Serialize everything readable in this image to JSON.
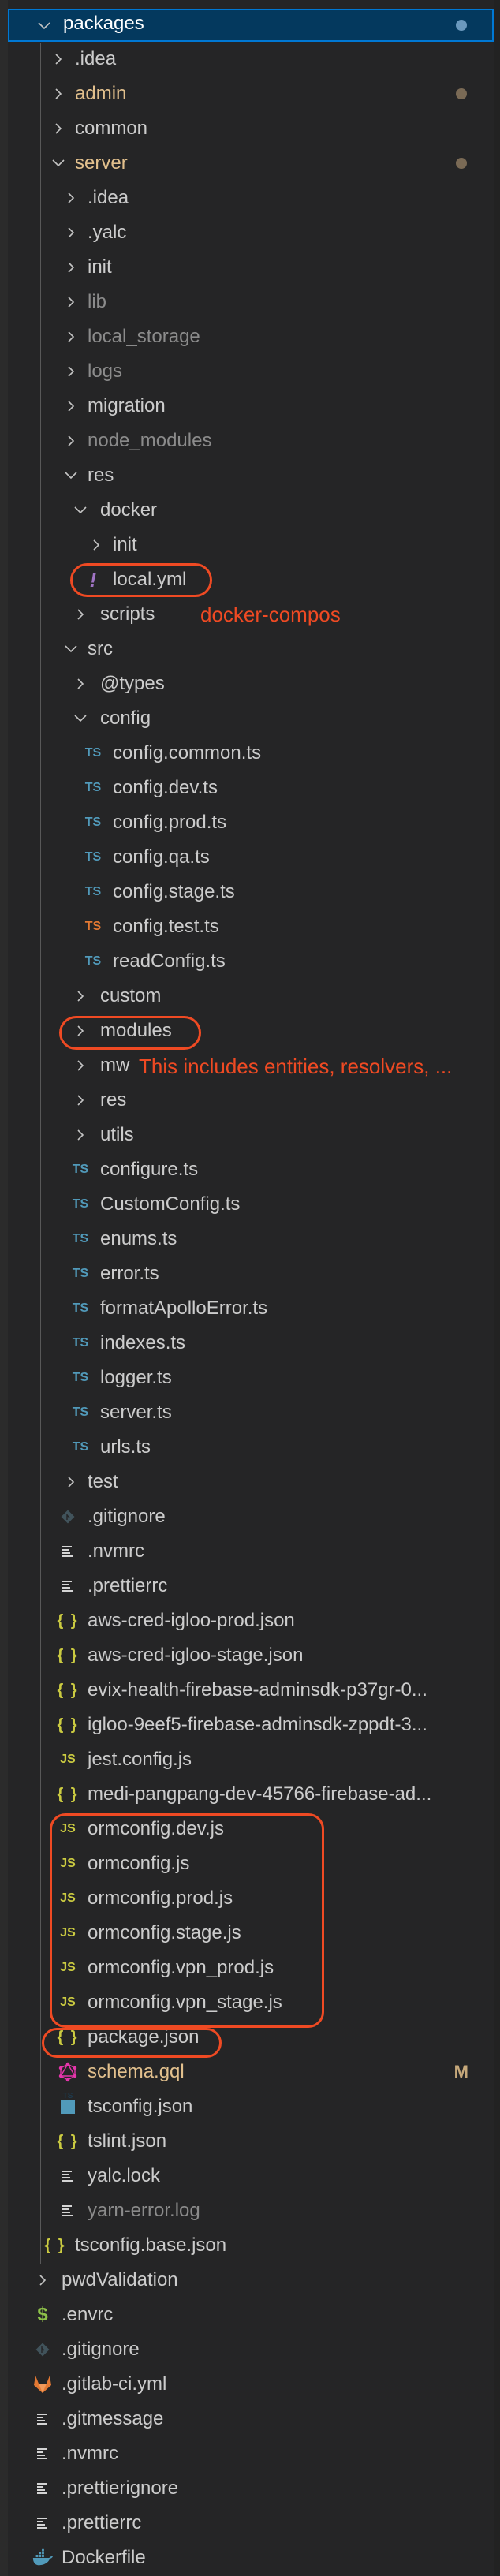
{
  "explorer": {
    "colors": {
      "background": "#252526",
      "selection": "#04395e",
      "selection_border": "#0078d4",
      "modified_text": "#e2c08d",
      "ignored_text": "#8b8b8b",
      "annotation": "#ef4a23"
    },
    "rows": [
      {
        "label": "packages",
        "depth": 0,
        "type": "folder",
        "expanded": true,
        "selected": true,
        "dot": true
      },
      {
        "label": ".idea",
        "depth": 1,
        "type": "folder",
        "expanded": false
      },
      {
        "label": "admin",
        "depth": 1,
        "type": "folder",
        "expanded": false,
        "modified": true,
        "dot": true
      },
      {
        "label": "common",
        "depth": 1,
        "type": "folder",
        "expanded": false
      },
      {
        "label": "server",
        "depth": 1,
        "type": "folder",
        "expanded": true,
        "modified": true,
        "dot": true
      },
      {
        "label": ".idea",
        "depth": 2,
        "type": "folder",
        "expanded": false
      },
      {
        "label": ".yalc",
        "depth": 2,
        "type": "folder",
        "expanded": false
      },
      {
        "label": "init",
        "depth": 2,
        "type": "folder",
        "expanded": false
      },
      {
        "label": "lib",
        "depth": 2,
        "type": "folder",
        "expanded": false,
        "dim": true
      },
      {
        "label": "local_storage",
        "depth": 2,
        "type": "folder",
        "expanded": false,
        "dim": true
      },
      {
        "label": "logs",
        "depth": 2,
        "type": "folder",
        "expanded": false,
        "dim": true
      },
      {
        "label": "migration",
        "depth": 2,
        "type": "folder",
        "expanded": false
      },
      {
        "label": "node_modules",
        "depth": 2,
        "type": "folder",
        "expanded": false,
        "dim": true
      },
      {
        "label": "res",
        "depth": 2,
        "type": "folder",
        "expanded": true
      },
      {
        "label": "docker",
        "depth": 3,
        "type": "folder",
        "expanded": true
      },
      {
        "label": "init",
        "depth": 4,
        "type": "folder",
        "expanded": false
      },
      {
        "label": "local.yml",
        "depth": 4,
        "type": "file",
        "icon": "yaml"
      },
      {
        "label": "scripts",
        "depth": 3,
        "type": "folder",
        "expanded": false
      },
      {
        "label": "src",
        "depth": 2,
        "type": "folder",
        "expanded": true
      },
      {
        "label": "@types",
        "depth": 3,
        "type": "folder",
        "expanded": false
      },
      {
        "label": "config",
        "depth": 3,
        "type": "folder",
        "expanded": true
      },
      {
        "label": "config.common.ts",
        "depth": 4,
        "type": "file",
        "icon": "ts"
      },
      {
        "label": "config.dev.ts",
        "depth": 4,
        "type": "file",
        "icon": "ts"
      },
      {
        "label": "config.prod.ts",
        "depth": 4,
        "type": "file",
        "icon": "ts"
      },
      {
        "label": "config.qa.ts",
        "depth": 4,
        "type": "file",
        "icon": "ts"
      },
      {
        "label": "config.stage.ts",
        "depth": 4,
        "type": "file",
        "icon": "ts"
      },
      {
        "label": "config.test.ts",
        "depth": 4,
        "type": "file",
        "icon": "ts-test"
      },
      {
        "label": "readConfig.ts",
        "depth": 4,
        "type": "file",
        "icon": "ts"
      },
      {
        "label": "custom",
        "depth": 3,
        "type": "folder",
        "expanded": false
      },
      {
        "label": "modules",
        "depth": 3,
        "type": "folder",
        "expanded": false
      },
      {
        "label": "mw",
        "depth": 3,
        "type": "folder",
        "expanded": false
      },
      {
        "label": "res",
        "depth": 3,
        "type": "folder",
        "expanded": false
      },
      {
        "label": "utils",
        "depth": 3,
        "type": "folder",
        "expanded": false
      },
      {
        "label": "configure.ts",
        "depth": 3,
        "type": "file",
        "icon": "ts"
      },
      {
        "label": "CustomConfig.ts",
        "depth": 3,
        "type": "file",
        "icon": "ts"
      },
      {
        "label": "enums.ts",
        "depth": 3,
        "type": "file",
        "icon": "ts"
      },
      {
        "label": "error.ts",
        "depth": 3,
        "type": "file",
        "icon": "ts"
      },
      {
        "label": "formatApolloError.ts",
        "depth": 3,
        "type": "file",
        "icon": "ts"
      },
      {
        "label": "indexes.ts",
        "depth": 3,
        "type": "file",
        "icon": "ts"
      },
      {
        "label": "logger.ts",
        "depth": 3,
        "type": "file",
        "icon": "ts"
      },
      {
        "label": "server.ts",
        "depth": 3,
        "type": "file",
        "icon": "ts"
      },
      {
        "label": "urls.ts",
        "depth": 3,
        "type": "file",
        "icon": "ts"
      },
      {
        "label": "test",
        "depth": 2,
        "type": "folder",
        "expanded": false
      },
      {
        "label": ".gitignore",
        "depth": 2,
        "type": "file",
        "icon": "git"
      },
      {
        "label": ".nvmrc",
        "depth": 2,
        "type": "file",
        "icon": "text"
      },
      {
        "label": ".prettierrc",
        "depth": 2,
        "type": "file",
        "icon": "text"
      },
      {
        "label": "aws-cred-igloo-prod.json",
        "depth": 2,
        "type": "file",
        "icon": "json"
      },
      {
        "label": "aws-cred-igloo-stage.json",
        "depth": 2,
        "type": "file",
        "icon": "json"
      },
      {
        "label": "evix-health-firebase-adminsdk-p37gr-0...",
        "depth": 2,
        "type": "file",
        "icon": "json"
      },
      {
        "label": "igloo-9eef5-firebase-adminsdk-zppdt-3...",
        "depth": 2,
        "type": "file",
        "icon": "json"
      },
      {
        "label": "jest.config.js",
        "depth": 2,
        "type": "file",
        "icon": "js"
      },
      {
        "label": "medi-pangpang-dev-45766-firebase-ad...",
        "depth": 2,
        "type": "file",
        "icon": "json"
      },
      {
        "label": "ormconfig.dev.js",
        "depth": 2,
        "type": "file",
        "icon": "js"
      },
      {
        "label": "ormconfig.js",
        "depth": 2,
        "type": "file",
        "icon": "js"
      },
      {
        "label": "ormconfig.prod.js",
        "depth": 2,
        "type": "file",
        "icon": "js"
      },
      {
        "label": "ormconfig.stage.js",
        "depth": 2,
        "type": "file",
        "icon": "js"
      },
      {
        "label": "ormconfig.vpn_prod.js",
        "depth": 2,
        "type": "file",
        "icon": "js"
      },
      {
        "label": "ormconfig.vpn_stage.js",
        "depth": 2,
        "type": "file",
        "icon": "js"
      },
      {
        "label": "package.json",
        "depth": 2,
        "type": "file",
        "icon": "json"
      },
      {
        "label": "schema.gql",
        "depth": 2,
        "type": "file",
        "icon": "graphql",
        "modified": true,
        "badge": "M"
      },
      {
        "label": "tsconfig.json",
        "depth": 2,
        "type": "file",
        "icon": "tsconfig"
      },
      {
        "label": "tslint.json",
        "depth": 2,
        "type": "file",
        "icon": "json"
      },
      {
        "label": "yalc.lock",
        "depth": 2,
        "type": "file",
        "icon": "text"
      },
      {
        "label": "yarn-error.log",
        "depth": 2,
        "type": "file",
        "icon": "text",
        "dim": true
      },
      {
        "label": "tsconfig.base.json",
        "depth": 1,
        "type": "file",
        "icon": "json"
      },
      {
        "label": "pwdValidation",
        "depth": 0,
        "type": "folder",
        "expanded": false
      },
      {
        "label": ".envrc",
        "depth": 0,
        "type": "file",
        "icon": "shell"
      },
      {
        "label": ".gitignore",
        "depth": 0,
        "type": "file",
        "icon": "git"
      },
      {
        "label": ".gitlab-ci.yml",
        "depth": 0,
        "type": "file",
        "icon": "gitlab"
      },
      {
        "label": ".gitmessage",
        "depth": 0,
        "type": "file",
        "icon": "text"
      },
      {
        "label": ".nvmrc",
        "depth": 0,
        "type": "file",
        "icon": "text"
      },
      {
        "label": ".prettierignore",
        "depth": 0,
        "type": "file",
        "icon": "text"
      },
      {
        "label": ".prettierrc",
        "depth": 0,
        "type": "file",
        "icon": "text"
      },
      {
        "label": "Dockerfile",
        "depth": 0,
        "type": "file",
        "icon": "docker"
      }
    ]
  },
  "annotations": {
    "docker_compose_note": "docker-compos",
    "modules_note": "This includes entities, resolvers, ...",
    "icon_glyphs": {
      "ts": "TS",
      "js": "JS",
      "json": "{ }",
      "yaml": "!",
      "shell": "$",
      "tsconfig": "TS"
    }
  }
}
